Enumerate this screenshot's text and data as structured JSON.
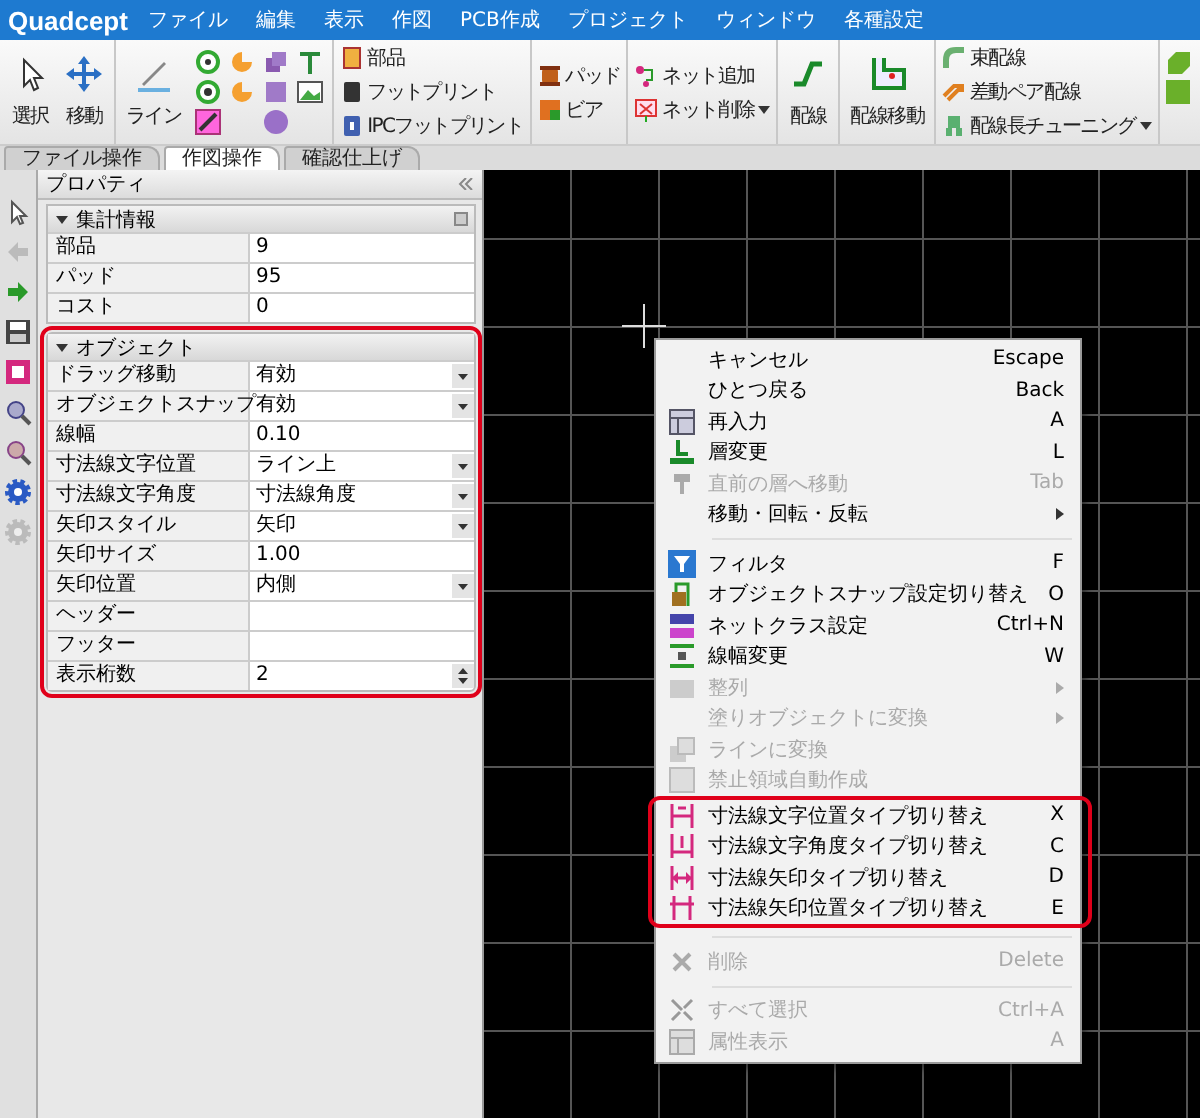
{
  "app": {
    "logo": "Quadcept",
    "menus": [
      "ファイル",
      "編集",
      "表示",
      "作図",
      "PCB作成",
      "プロジェクト",
      "ウィンドウ",
      "各種設定"
    ]
  },
  "ribbon": {
    "groups": [
      {
        "kind": "large",
        "items": [
          {
            "label": "選択"
          },
          {
            "label": "移動"
          }
        ]
      },
      {
        "kind": "large-grid",
        "items": [
          {
            "label": "ライン"
          }
        ]
      },
      {
        "kind": "stack",
        "items": [
          {
            "label": "部品",
            "dropdown": false
          },
          {
            "label": "フットプリント",
            "dropdown": false
          },
          {
            "label": "IPCフットプリント",
            "dropdown": false
          }
        ]
      },
      {
        "kind": "stack",
        "items": [
          {
            "label": "パッド",
            "dropdown": false
          },
          {
            "label": "ビア",
            "dropdown": false
          }
        ]
      },
      {
        "kind": "stack",
        "items": [
          {
            "label": "ネット追加",
            "dropdown": false
          },
          {
            "label": "ネット削除",
            "dropdown": true
          }
        ]
      },
      {
        "kind": "large",
        "items": [
          {
            "label": "配線"
          }
        ]
      },
      {
        "kind": "large",
        "items": [
          {
            "label": "配線移動"
          }
        ]
      },
      {
        "kind": "stack",
        "items": [
          {
            "label": "束配線",
            "dropdown": false
          },
          {
            "label": "差動ペア配線",
            "dropdown": false
          },
          {
            "label": "配線長チューニング",
            "dropdown": true
          }
        ]
      },
      {
        "kind": "grid"
      }
    ],
    "tabs": [
      {
        "label": "ファイル操作",
        "selected": false
      },
      {
        "label": "作図操作",
        "selected": true
      },
      {
        "label": "確認仕上げ",
        "selected": false
      }
    ]
  },
  "properties": {
    "title": "プロパティ",
    "sections": [
      {
        "title": "集計情報",
        "highlighted": false,
        "rows": [
          {
            "label": "部品",
            "value": "9",
            "kind": "text"
          },
          {
            "label": "パッド",
            "value": "95",
            "kind": "text"
          },
          {
            "label": "コスト",
            "value": "0",
            "kind": "text"
          }
        ]
      },
      {
        "title": "オブジェクト",
        "highlighted": true,
        "rows": [
          {
            "label": "ドラッグ移動",
            "value": "有効",
            "kind": "dropdown"
          },
          {
            "label": "オブジェクトスナップ",
            "value": "有効",
            "kind": "dropdown"
          },
          {
            "label": "線幅",
            "value": "0.10",
            "kind": "text"
          },
          {
            "label": "寸法線文字位置",
            "value": "ライン上",
            "kind": "dropdown"
          },
          {
            "label": "寸法線文字角度",
            "value": "寸法線角度",
            "kind": "dropdown"
          },
          {
            "label": "矢印スタイル",
            "value": "矢印",
            "kind": "dropdown"
          },
          {
            "label": "矢印サイズ",
            "value": "1.00",
            "kind": "text"
          },
          {
            "label": "矢印位置",
            "value": "内側",
            "kind": "dropdown"
          },
          {
            "label": "ヘッダー",
            "kind": "text"
          },
          {
            "label": "フッター",
            "kind": "text"
          },
          {
            "label": "表示桁数",
            "value": "2",
            "kind": "spin"
          }
        ]
      }
    ]
  },
  "context_menu": {
    "items": [
      {
        "kind": "item",
        "label": "キャンセル",
        "shortcut": "Escape",
        "disabled": false,
        "submenu": false,
        "highlighted": false,
        "has_icon": false
      },
      {
        "kind": "item",
        "label": "ひとつ戻る",
        "shortcut": "Back",
        "disabled": false,
        "submenu": false,
        "highlighted": false,
        "has_icon": false
      },
      {
        "kind": "item",
        "label": "再入力",
        "shortcut": "A",
        "disabled": false,
        "submenu": false,
        "highlighted": false,
        "has_icon": true
      },
      {
        "kind": "item",
        "label": "層変更",
        "shortcut": "L",
        "disabled": false,
        "submenu": false,
        "highlighted": false,
        "has_icon": true
      },
      {
        "kind": "item",
        "label": "直前の層へ移動",
        "shortcut": "Tab",
        "disabled": true,
        "submenu": false,
        "highlighted": false,
        "has_icon": true
      },
      {
        "kind": "item",
        "label": "移動・回転・反転",
        "disabled": false,
        "submenu": true,
        "highlighted": false,
        "has_icon": false
      },
      {
        "kind": "separator"
      },
      {
        "kind": "item",
        "label": "フィルタ",
        "shortcut": "F",
        "disabled": false,
        "submenu": false,
        "highlighted": false,
        "has_icon": true
      },
      {
        "kind": "item",
        "label": "オブジェクトスナップ設定切り替え",
        "shortcut": "O",
        "disabled": false,
        "submenu": false,
        "highlighted": false,
        "has_icon": true
      },
      {
        "kind": "item",
        "label": "ネットクラス設定",
        "shortcut": "Ctrl+N",
        "disabled": false,
        "submenu": false,
        "highlighted": false,
        "has_icon": true
      },
      {
        "kind": "item",
        "label": "線幅変更",
        "shortcut": "W",
        "disabled": false,
        "submenu": false,
        "highlighted": false,
        "has_icon": true
      },
      {
        "kind": "item",
        "label": "整列",
        "disabled": true,
        "submenu": true,
        "highlighted": false,
        "has_icon": true
      },
      {
        "kind": "item",
        "label": "塗りオブジェクトに変換",
        "disabled": true,
        "submenu": true,
        "highlighted": false,
        "has_icon": false
      },
      {
        "kind": "item",
        "label": "ラインに変換",
        "disabled": true,
        "submenu": false,
        "highlighted": false,
        "has_icon": true
      },
      {
        "kind": "item",
        "label": "禁止領域自動作成",
        "disabled": true,
        "submenu": false,
        "highlighted": false,
        "has_icon": true
      },
      {
        "kind": "item",
        "label": "寸法線文字位置タイプ切り替え",
        "shortcut": "X",
        "disabled": false,
        "submenu": false,
        "highlighted": true,
        "has_icon": true
      },
      {
        "kind": "item",
        "label": "寸法線文字角度タイプ切り替え",
        "shortcut": "C",
        "disabled": false,
        "submenu": false,
        "highlighted": true,
        "has_icon": true
      },
      {
        "kind": "item",
        "label": "寸法線矢印タイプ切り替え",
        "shortcut": "D",
        "disabled": false,
        "submenu": false,
        "highlighted": true,
        "has_icon": true
      },
      {
        "kind": "item",
        "label": "寸法線矢印位置タイプ切り替え",
        "shortcut": "E",
        "disabled": false,
        "submenu": false,
        "highlighted": true,
        "has_icon": true
      },
      {
        "kind": "separator"
      },
      {
        "kind": "item",
        "label": "削除",
        "shortcut": "Delete",
        "disabled": true,
        "submenu": false,
        "highlighted": false,
        "has_icon": true
      },
      {
        "kind": "separator"
      },
      {
        "kind": "item",
        "label": "すべて選択",
        "shortcut": "Ctrl+A",
        "disabled": true,
        "submenu": false,
        "highlighted": false,
        "has_icon": true
      },
      {
        "kind": "item",
        "label": "属性表示",
        "shortcut": "A",
        "disabled": true,
        "submenu": false,
        "highlighted": false,
        "has_icon": true
      }
    ]
  }
}
